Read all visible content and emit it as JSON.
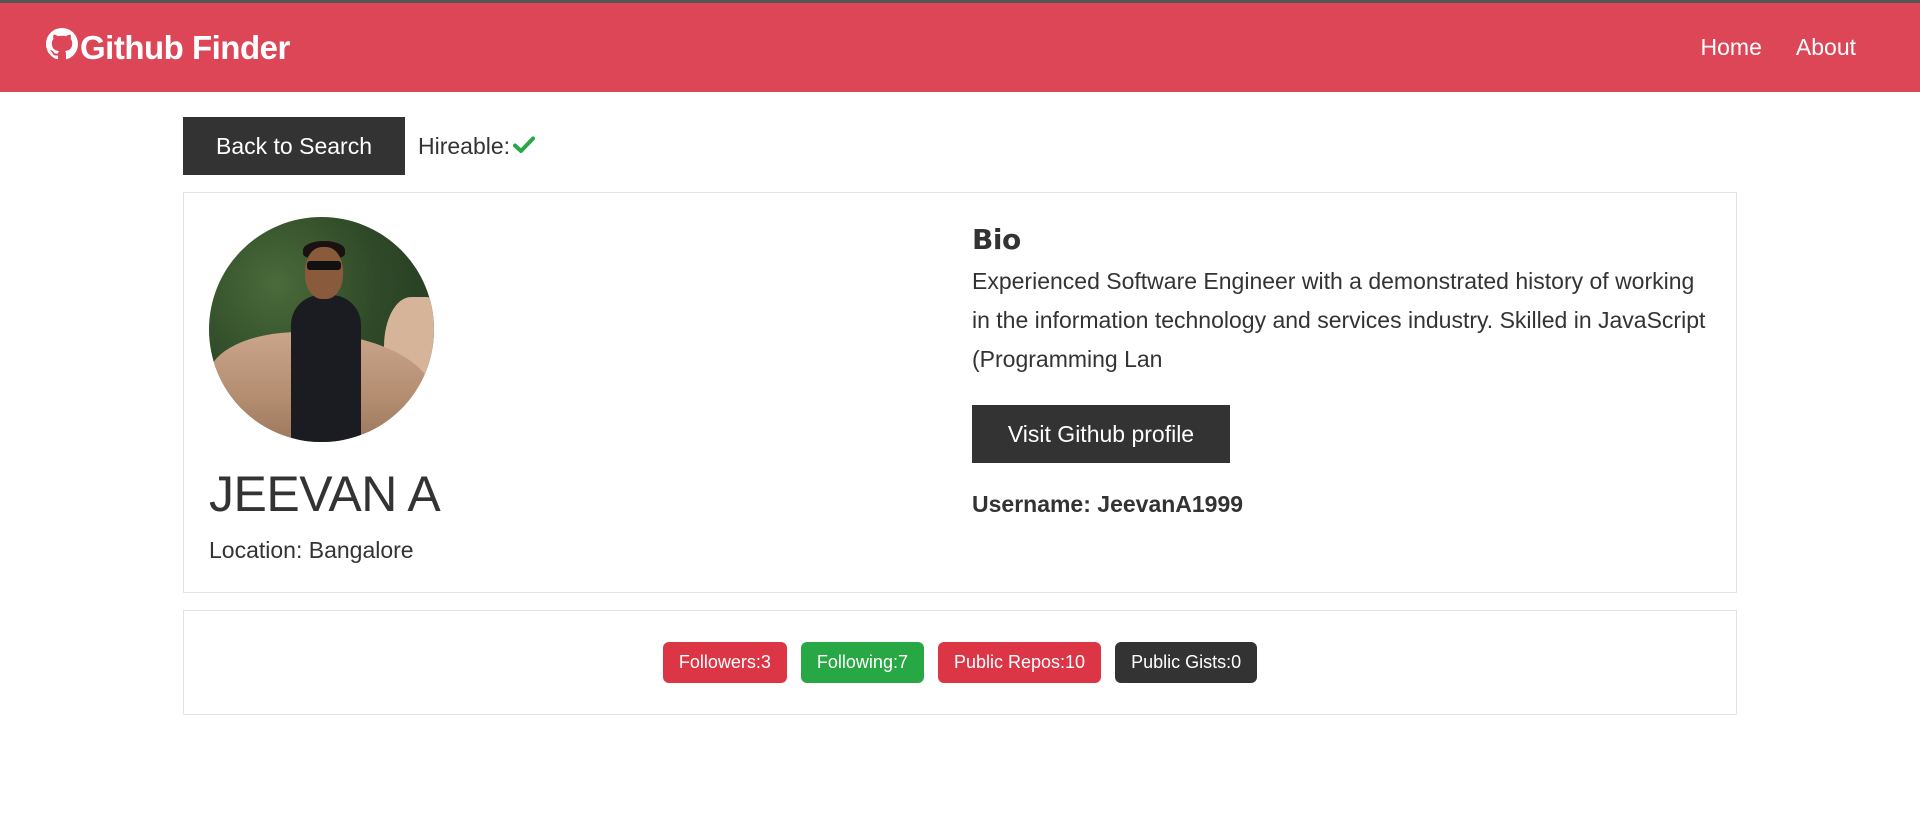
{
  "navbar": {
    "brand": "Github Finder",
    "links": [
      "Home",
      "About"
    ]
  },
  "actions": {
    "back_label": "Back to Search",
    "hireable_label": "Hireable:"
  },
  "profile": {
    "name": "JEEVAN A",
    "location": "Location: Bangalore",
    "bio_heading": "Bio",
    "bio": "Experienced Software Engineer with a demonstrated history of working in the information technology and services industry. Skilled in JavaScript (Programming Lan",
    "visit_label": "Visit Github profile",
    "username": "Username: JeevanA1999"
  },
  "stats": {
    "followers": "Followers:3",
    "following": "Following:7",
    "repos": "Public Repos:10",
    "gists": "Public Gists:0"
  },
  "colors": {
    "primary": "#dc4657",
    "dark": "#333333",
    "success": "#28a745",
    "danger": "#dc3545"
  },
  "icons": {
    "brand": "github-icon",
    "hireable": "check-icon"
  }
}
